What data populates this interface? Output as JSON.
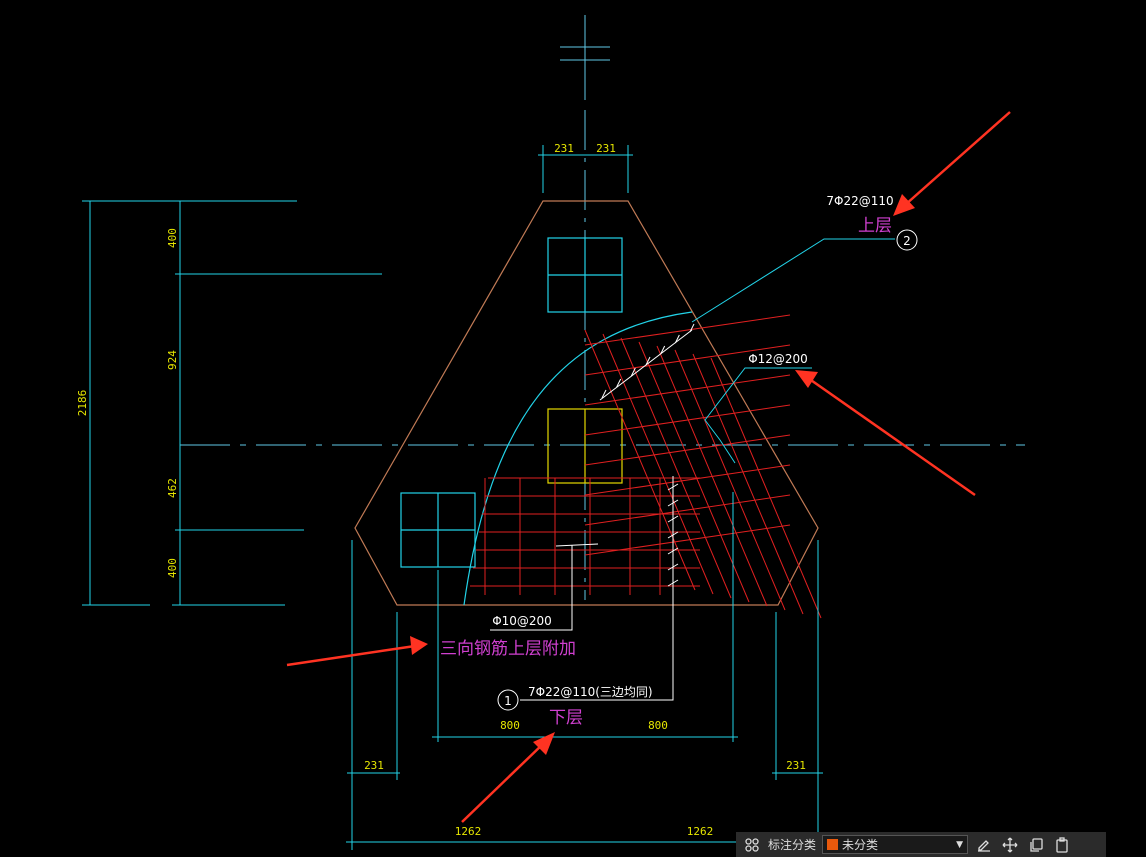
{
  "drawing": {
    "dims_left": [
      "400",
      "924",
      "462",
      "400"
    ],
    "dim_total": "2186",
    "dims_top": [
      "231",
      "231"
    ],
    "dims_bottom_small_left": "231",
    "dims_bottom_small_right": "231",
    "dims_mid": [
      "800",
      "800"
    ],
    "dims_bottom": [
      "1262",
      "1262"
    ],
    "rebar_top": "7Φ22@110",
    "rebar_top_layer": "上层",
    "rebar_top_mark": "2",
    "rebar_side": "Φ12@200",
    "rebar_add": "Φ10@200",
    "rebar_add_note": "三向钢筋上层附加",
    "rebar_bottom": "7Φ22@110(三边均同)",
    "rebar_bottom_layer": "下层",
    "rebar_bottom_mark": "1"
  },
  "toolbar": {
    "label": "标注分类",
    "select_value": "未分类",
    "swatch_color": "#e8590c"
  }
}
